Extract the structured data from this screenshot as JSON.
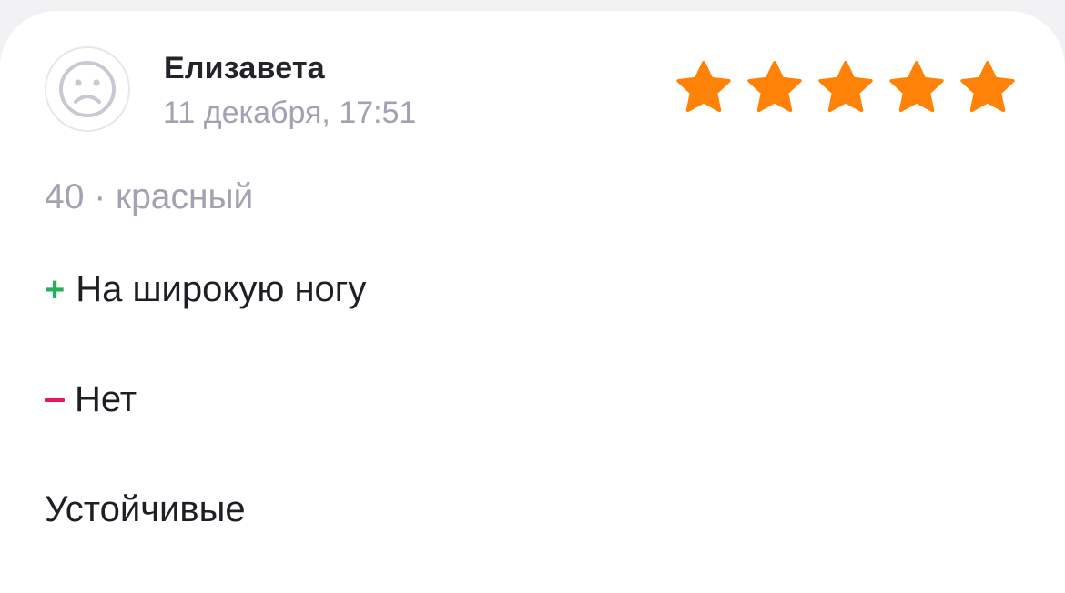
{
  "review": {
    "author": "Елизавета",
    "date": "11 декабря, 17:51",
    "avatar_icon": "sad-face-icon",
    "rating": 5,
    "rating_max": 5,
    "variant": "40 · красный",
    "pros": {
      "sign": "+",
      "text": "На широкую ногу"
    },
    "cons": {
      "sign": "–",
      "text": "Нет"
    },
    "comment": "Устойчивые"
  },
  "colors": {
    "star": "#ff8208",
    "plus": "#22b35a",
    "minus": "#e8175d",
    "muted_text": "#a2a2b2"
  }
}
